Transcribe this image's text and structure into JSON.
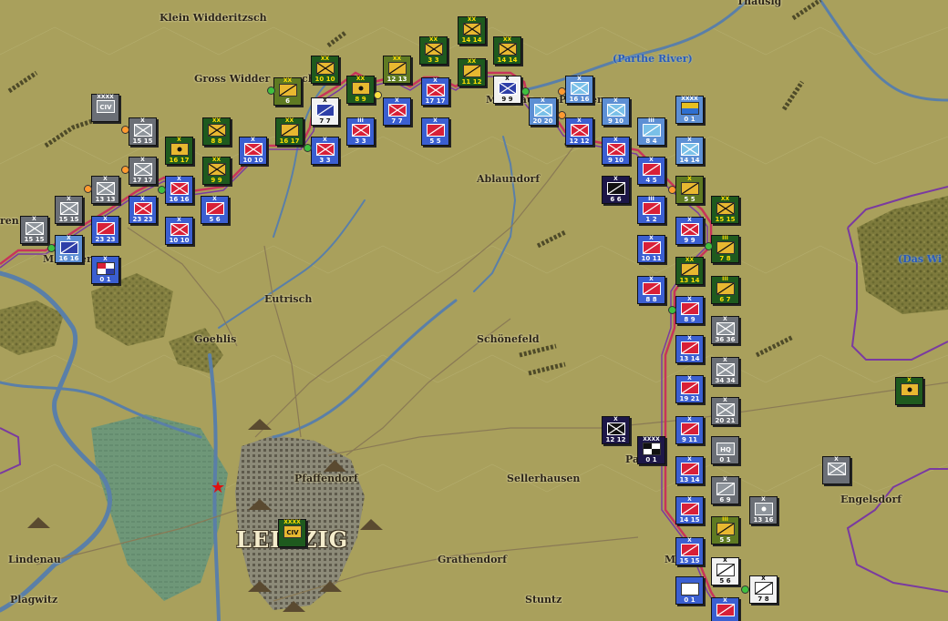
{
  "map": {
    "places": [
      {
        "name": "Klein Widderitzsch"
      },
      {
        "name": "Gross Widder"
      },
      {
        "name": "ch"
      },
      {
        "name": "(Parthe River)"
      },
      {
        "name": "Ablaundorf"
      },
      {
        "name": "M"
      },
      {
        "name": "gau"
      },
      {
        "name": "P"
      },
      {
        "name": "en"
      },
      {
        "name": "ren"
      },
      {
        "name": "M"
      },
      {
        "name": "er"
      },
      {
        "name": "Eutrisch"
      },
      {
        "name": "Goehlis"
      },
      {
        "name": "Schönefeld"
      },
      {
        "name": "(Das Wi"
      },
      {
        "name": "Pfaffendorf"
      },
      {
        "name": "LEI"
      },
      {
        "name": "ZIG"
      },
      {
        "name": "Sellerhausen"
      },
      {
        "name": "Pa"
      },
      {
        "name": "Engelsdorf"
      },
      {
        "name": "Lindenau"
      },
      {
        "name": "Plagwitz"
      },
      {
        "name": "Grathendorf"
      },
      {
        "name": "Stuntz"
      },
      {
        "name": "M"
      },
      {
        "name": "Thausig"
      }
    ],
    "counters": [
      {
        "id": "c1",
        "size": "XXXX",
        "label": "CIV",
        "str": "",
        "face": "gry",
        "sym": "gry",
        "kind": "text"
      },
      {
        "id": "c2",
        "size": "X",
        "label": "",
        "str": "15 15",
        "face": "gry",
        "sym": "gry",
        "kind": "cross"
      },
      {
        "id": "c3",
        "size": "XX",
        "label": "",
        "str": "8 8",
        "face": "grn",
        "sym": "ora",
        "kind": "cross"
      },
      {
        "id": "c4",
        "size": "X",
        "label": "",
        "str": "16 17",
        "face": "grn",
        "sym": "ora",
        "kind": "dot"
      },
      {
        "id": "c5",
        "size": "XX",
        "label": "",
        "str": "9 9",
        "face": "grn",
        "sym": "ora",
        "kind": "cross"
      },
      {
        "id": "c6",
        "size": "X",
        "label": "",
        "str": "17 17",
        "face": "gry",
        "sym": "gry",
        "kind": "cross"
      },
      {
        "id": "c7",
        "size": "X",
        "label": "",
        "str": "16 16",
        "face": "red",
        "sym": "red",
        "kind": "cross"
      },
      {
        "id": "c8",
        "size": "X",
        "label": "",
        "str": "13 13",
        "face": "gry",
        "sym": "gry",
        "kind": "cross"
      },
      {
        "id": "c9",
        "size": "X",
        "label": "",
        "str": "15 15",
        "face": "gry",
        "sym": "gry",
        "kind": "cross"
      },
      {
        "id": "c10",
        "size": "X",
        "label": "",
        "str": "23 23",
        "face": "red",
        "sym": "red",
        "kind": "cross"
      },
      {
        "id": "c11",
        "size": "X",
        "label": "",
        "str": "23 23",
        "face": "red",
        "sym": "red",
        "kind": "slash"
      },
      {
        "id": "c12",
        "size": "X",
        "label": "",
        "str": "15 15",
        "face": "gry",
        "sym": "gry",
        "kind": "cross"
      },
      {
        "id": "c13",
        "size": "X",
        "label": "",
        "str": "16 16",
        "face": "lbl",
        "sym": "blu",
        "kind": "slash"
      },
      {
        "id": "c14",
        "size": "X",
        "label": "",
        "str": "0 1",
        "face": "red",
        "sym": "wht",
        "kind": "flag"
      },
      {
        "id": "c15",
        "size": "X",
        "label": "",
        "str": "10 10",
        "face": "red",
        "sym": "red",
        "kind": "cross"
      },
      {
        "id": "c16",
        "size": "X",
        "label": "",
        "str": "5 6",
        "face": "red",
        "sym": "red",
        "kind": "slash"
      },
      {
        "id": "c17",
        "size": "X",
        "label": "",
        "str": "10 10",
        "face": "red",
        "sym": "red",
        "kind": "cross"
      },
      {
        "id": "c18",
        "size": "XX",
        "label": "",
        "str": "6",
        "face": "oli",
        "sym": "ora",
        "kind": "slash"
      },
      {
        "id": "c19",
        "size": "XX",
        "label": "",
        "str": "16 17",
        "face": "grn",
        "sym": "ora",
        "kind": "slash"
      },
      {
        "id": "c20",
        "size": "XX",
        "label": "",
        "str": "10 10",
        "face": "grn",
        "sym": "ora",
        "kind": "cross"
      },
      {
        "id": "c21",
        "size": "X",
        "label": "",
        "str": "7 7",
        "face": "wht",
        "sym": "blu",
        "kind": "slash"
      },
      {
        "id": "c22",
        "size": "X",
        "label": "",
        "str": "3 3",
        "face": "red",
        "sym": "red",
        "kind": "cross"
      },
      {
        "id": "c23",
        "size": "XX",
        "label": "",
        "str": "8 9",
        "face": "grn",
        "sym": "ora",
        "kind": "dot"
      },
      {
        "id": "c24",
        "size": "III",
        "label": "",
        "str": "3 3",
        "face": "red",
        "sym": "red",
        "kind": "cross"
      },
      {
        "id": "c25",
        "size": "XX",
        "label": "",
        "str": "12 13",
        "face": "oli",
        "sym": "ora",
        "kind": "slash"
      },
      {
        "id": "c26",
        "size": "X",
        "label": "",
        "str": "7 7",
        "face": "red",
        "sym": "red",
        "kind": "cross"
      },
      {
        "id": "c27",
        "size": "XX",
        "label": "",
        "str": "3 3",
        "face": "grn",
        "sym": "ora",
        "kind": "cross"
      },
      {
        "id": "c28",
        "size": "X",
        "label": "",
        "str": "17 17",
        "face": "red",
        "sym": "red",
        "kind": "cross"
      },
      {
        "id": "c29",
        "size": "X",
        "label": "",
        "str": "5 5",
        "face": "red",
        "sym": "red",
        "kind": "slash"
      },
      {
        "id": "c30",
        "size": "XX",
        "label": "",
        "str": "14 14",
        "face": "grn",
        "sym": "ora",
        "kind": "cross"
      },
      {
        "id": "c31",
        "size": "XX",
        "label": "",
        "str": "11 12",
        "face": "grn",
        "sym": "ora",
        "kind": "slash"
      },
      {
        "id": "c32",
        "size": "XX",
        "label": "",
        "str": "14 14",
        "face": "grn",
        "sym": "ora",
        "kind": "cross"
      },
      {
        "id": "c33",
        "size": "X",
        "label": "",
        "str": "9 9",
        "face": "wht",
        "sym": "blu",
        "kind": "cross"
      },
      {
        "id": "c34",
        "size": "X",
        "label": "",
        "str": "20 20",
        "face": "lbl",
        "sym": "lbl",
        "kind": "cross"
      },
      {
        "id": "c35",
        "size": "X",
        "label": "",
        "str": "16 16",
        "face": "lbl",
        "sym": "lbl",
        "kind": "cross"
      },
      {
        "id": "c36",
        "size": "X",
        "label": "",
        "str": "12 12",
        "face": "red",
        "sym": "red",
        "kind": "cross"
      },
      {
        "id": "c37",
        "size": "X",
        "label": "",
        "str": "9 10",
        "face": "lbl",
        "sym": "lbl",
        "kind": "cross"
      },
      {
        "id": "c38",
        "size": "XXXX",
        "label": "",
        "str": "0 1",
        "face": "lbl",
        "sym": "wht",
        "kind": "flag2"
      },
      {
        "id": "c39",
        "size": "III",
        "label": "",
        "str": "8 4",
        "face": "lbl",
        "sym": "lbl",
        "kind": "slash"
      },
      {
        "id": "c40",
        "size": "X",
        "label": "",
        "str": "9 10",
        "face": "red",
        "sym": "red",
        "kind": "cross"
      },
      {
        "id": "c41",
        "size": "X",
        "label": "",
        "str": "14 14",
        "face": "lbl",
        "sym": "lbl",
        "kind": "cross"
      },
      {
        "id": "c42",
        "size": "X",
        "label": "",
        "str": "6 6",
        "face": "nav",
        "sym": "blk",
        "kind": "slash"
      },
      {
        "id": "c43",
        "size": "X",
        "label": "",
        "str": "4 5",
        "face": "red",
        "sym": "red",
        "kind": "slash"
      },
      {
        "id": "c44",
        "size": "X",
        "label": "",
        "str": "5 5",
        "face": "oli",
        "sym": "ora",
        "kind": "slash"
      },
      {
        "id": "c45",
        "size": "XX",
        "label": "",
        "str": "15 15",
        "face": "grn",
        "sym": "ora",
        "kind": "cross"
      },
      {
        "id": "c46",
        "size": "III",
        "label": "",
        "str": "1 2",
        "face": "red",
        "sym": "red",
        "kind": "slash"
      },
      {
        "id": "c47",
        "size": "X",
        "label": "",
        "str": "9 9",
        "face": "red",
        "sym": "red",
        "kind": "cross"
      },
      {
        "id": "c48",
        "size": "III",
        "label": "",
        "str": "7 8",
        "face": "grn",
        "sym": "ora",
        "kind": "slash"
      },
      {
        "id": "c49",
        "size": "X",
        "label": "",
        "str": "10 11",
        "face": "red",
        "sym": "red",
        "kind": "slash"
      },
      {
        "id": "c50",
        "size": "XX",
        "label": "",
        "str": "13 14",
        "face": "grn",
        "sym": "ora",
        "kind": "slash"
      },
      {
        "id": "c51",
        "size": "III",
        "label": "",
        "str": "6 7",
        "face": "grn",
        "sym": "ora",
        "kind": "slash"
      },
      {
        "id": "c52",
        "size": "X",
        "label": "",
        "str": "8 8",
        "face": "red",
        "sym": "red",
        "kind": "slash"
      },
      {
        "id": "c53",
        "size": "X",
        "label": "",
        "str": "8 9",
        "face": "red",
        "sym": "red",
        "kind": "slash"
      },
      {
        "id": "c54",
        "size": "X",
        "label": "",
        "str": "36 36",
        "face": "gry",
        "sym": "gry",
        "kind": "cross"
      },
      {
        "id": "c55",
        "size": "X",
        "label": "",
        "str": "13 14",
        "face": "red",
        "sym": "red",
        "kind": "slash"
      },
      {
        "id": "c56",
        "size": "X",
        "label": "",
        "str": "34 34",
        "face": "gry",
        "sym": "gry",
        "kind": "cross"
      },
      {
        "id": "c57",
        "size": "X",
        "label": "",
        "str": "19 21",
        "face": "red",
        "sym": "red",
        "kind": "slash"
      },
      {
        "id": "c58",
        "size": "X",
        "label": "",
        "str": "20 21",
        "face": "gry",
        "sym": "gry",
        "kind": "cross"
      },
      {
        "id": "c59",
        "size": "X",
        "label": "",
        "str": "",
        "face": "grn",
        "sym": "ora",
        "kind": "dot"
      },
      {
        "id": "c60",
        "size": "X",
        "label": "",
        "str": "12 12",
        "face": "nav",
        "sym": "blk",
        "kind": "cross"
      },
      {
        "id": "c61",
        "size": "XXXX",
        "label": "",
        "str": "0 1",
        "face": "nav",
        "sym": "wht",
        "kind": "flag3"
      },
      {
        "id": "c62",
        "size": "X",
        "label": "",
        "str": "9 11",
        "face": "red",
        "sym": "red",
        "kind": "slash"
      },
      {
        "id": "c63",
        "size": "",
        "label": "HQ",
        "str": "0 1",
        "face": "gry",
        "sym": "gry",
        "kind": "text"
      },
      {
        "id": "c64",
        "size": "X",
        "label": "",
        "str": "",
        "face": "gry",
        "sym": "gry",
        "kind": "cross"
      },
      {
        "id": "c65",
        "size": "X",
        "label": "",
        "str": "13 14",
        "face": "red",
        "sym": "red",
        "kind": "slash"
      },
      {
        "id": "c66",
        "size": "X",
        "label": "",
        "str": "6 9",
        "face": "gry",
        "sym": "gry",
        "kind": "slash"
      },
      {
        "id": "c67",
        "size": "X",
        "label": "",
        "str": "13 16",
        "face": "gry",
        "sym": "gry",
        "kind": "dot"
      },
      {
        "id": "c68",
        "size": "X",
        "label": "",
        "str": "14 15",
        "face": "red",
        "sym": "red",
        "kind": "slash"
      },
      {
        "id": "c69",
        "size": "III",
        "label": "",
        "str": "5 5",
        "face": "oli",
        "sym": "ora",
        "kind": "slash"
      },
      {
        "id": "c70",
        "size": "X",
        "label": "",
        "str": "15 15",
        "face": "red",
        "sym": "red",
        "kind": "slash"
      },
      {
        "id": "c71",
        "size": "X",
        "label": "",
        "str": "5 6",
        "face": "wht",
        "sym": "wht",
        "kind": "slash"
      },
      {
        "id": "c72",
        "size": "X",
        "label": "",
        "str": "7 8",
        "face": "wht",
        "sym": "wht",
        "kind": "slash"
      },
      {
        "id": "c73",
        "size": "",
        "label": "HQ",
        "str": "0 1",
        "face": "red",
        "sym": "wht",
        "kind": "text"
      },
      {
        "id": "c74",
        "size": "XXXX",
        "label": "CIV",
        "str": "",
        "face": "grn",
        "sym": "ora",
        "kind": "text"
      },
      {
        "id": "c75",
        "size": "X",
        "label": "",
        "str": "",
        "face": "red",
        "sym": "red",
        "kind": "slash"
      }
    ]
  }
}
